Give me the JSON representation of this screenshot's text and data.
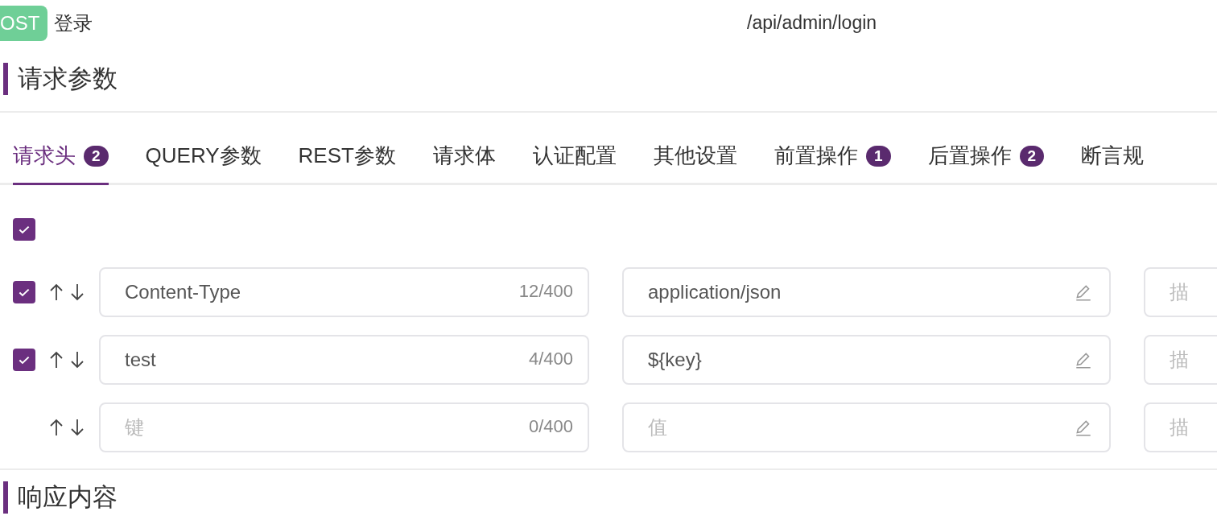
{
  "request": {
    "method": "OST",
    "name": "登录",
    "url": "/api/admin/login"
  },
  "sections": [
    {
      "title": "请求参数"
    },
    {
      "title": "响应内容"
    }
  ],
  "tabs": [
    {
      "label": "请求头",
      "badge": "2",
      "selected": true
    },
    {
      "label": "QUERY参数",
      "selected": false
    },
    {
      "label": "REST参数",
      "selected": false
    },
    {
      "label": "请求体",
      "selected": false
    },
    {
      "label": "认证配置",
      "selected": false
    },
    {
      "label": "其他设置",
      "selected": false
    },
    {
      "label": "前置操作",
      "badge": "1",
      "selected": false
    },
    {
      "label": "后置操作",
      "badge": "2",
      "selected": false
    },
    {
      "label": "断言规",
      "selected": false
    }
  ],
  "select_all": {
    "checked": true
  },
  "rows": [
    {
      "kind": "header",
      "checked": true,
      "key": "Content-Type",
      "key_count": "12/400",
      "value": "application/json",
      "description_placeholder": "描"
    },
    {
      "kind": "header",
      "checked": true,
      "key": "test",
      "key_count": "4/400",
      "value": "${key}",
      "description_placeholder": "描"
    },
    {
      "kind": "new",
      "key_placeholder": "键",
      "key_count": "0/400",
      "value_placeholder": "值",
      "description_placeholder": "描"
    }
  ]
}
